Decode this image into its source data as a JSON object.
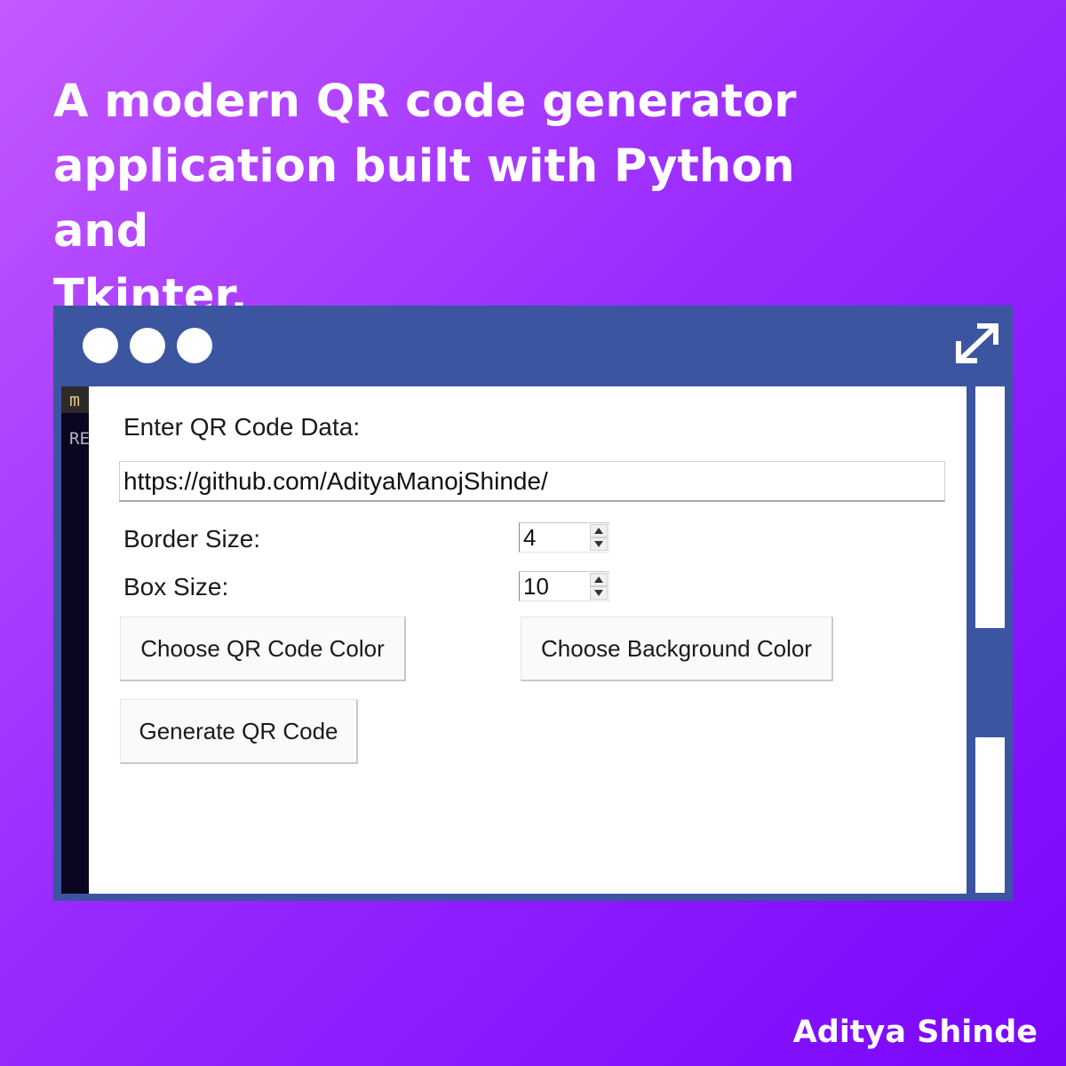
{
  "headline": {
    "line1": "A modern QR code generator",
    "line2": "application built with Python and",
    "line3": "Tkinter."
  },
  "window": {
    "title_bar_dots": [
      "dot",
      "dot",
      "dot"
    ],
    "expand_icon": "expand-arrows-icon",
    "accent_color": "#3b55a0"
  },
  "editor": {
    "tab_text": "m",
    "line_text": "RE"
  },
  "app": {
    "data_label": "Enter QR Code Data:",
    "data_value": "https://github.com/AdityaManojShinde/",
    "border_label": "Border Size:",
    "border_value": "4",
    "box_label": "Box Size:",
    "box_value": "10",
    "qr_color_button": "Choose QR Code Color",
    "bg_color_button": "Choose Background Color",
    "generate_button": "Generate QR Code"
  },
  "signature": "Aditya Shinde"
}
